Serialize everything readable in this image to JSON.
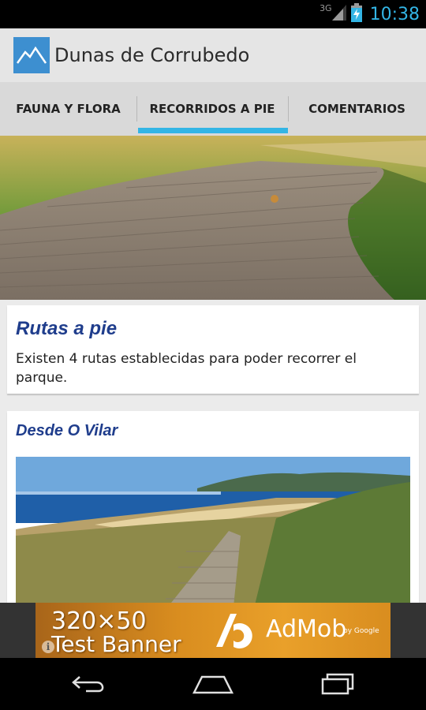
{
  "status_bar": {
    "network_label": "3G",
    "time": "10:38"
  },
  "action_bar": {
    "title": "Dunas de Corrubedo",
    "icon": "mountain-icon"
  },
  "tabs": [
    {
      "label": "FAUNA Y FLORA",
      "selected": false
    },
    {
      "label": "RECORRIDOS A PIE",
      "selected": true
    },
    {
      "label": "COMENTARIOS",
      "selected": false
    }
  ],
  "colors": {
    "accent": "#33b5e5",
    "card_title": "#1f3d8c",
    "app_icon_bg": "#3d8fd0"
  },
  "cards": [
    {
      "title": "Rutas a pie",
      "text": "Existen 4 rutas establecidas para poder recorrer el parque."
    },
    {
      "title": "Desde O Vilar"
    }
  ],
  "ad": {
    "line1": "320×50",
    "line2": "Test Banner",
    "brand": "AdMob",
    "by": "by Google",
    "info": "i"
  },
  "nav": {
    "back_icon": "back-icon",
    "home_icon": "home-icon",
    "recent_icon": "recent-apps-icon"
  }
}
